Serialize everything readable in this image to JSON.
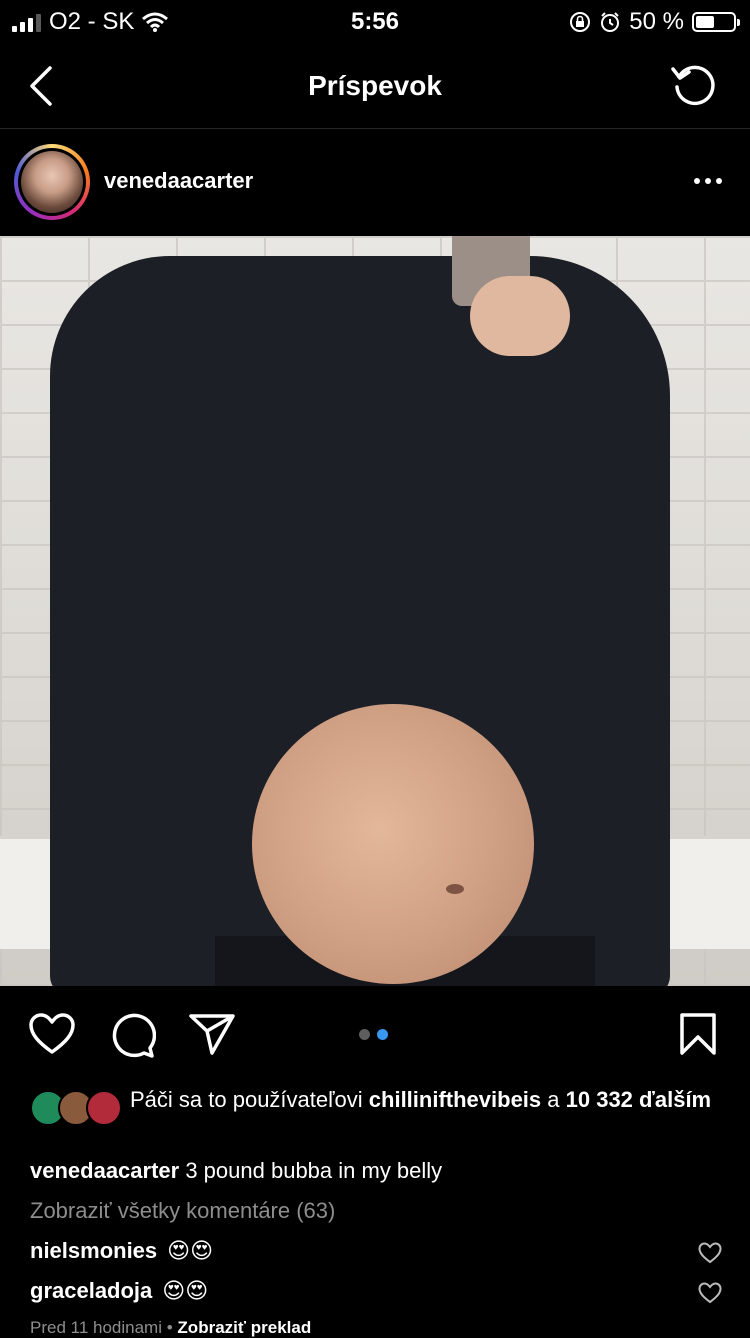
{
  "status_bar": {
    "carrier": "O2 - SK",
    "time": "5:56",
    "battery": "50 %"
  },
  "nav": {
    "title": "Príspevok"
  },
  "post": {
    "username": "venedaacarter",
    "carousel_dots": 2,
    "active_dot": 1
  },
  "likes": {
    "prefix": "Páči sa to používateľovi ",
    "user": "chillinifthevibeis",
    "middle": " a ",
    "count": "10 332",
    "suffix": "ďalším"
  },
  "caption": {
    "user": "venedaacarter",
    "text": " 3 pound bubba in my belly"
  },
  "view_all_comments": "Zobraziť všetky komentáre (63)",
  "comments": [
    {
      "user": "nielsmonies",
      "text": "😍😍"
    },
    {
      "user": "graceladoja",
      "text": "😍😍"
    }
  ],
  "meta": {
    "time_ago": "Pred 11 hodinami",
    "separator": "•",
    "translate": "Zobraziť preklad"
  },
  "colors": {
    "background": "#000000",
    "dot_active": "#3897f0",
    "dot_inactive": "#5e5e5e",
    "secondary_text": "#8e8e8e"
  }
}
